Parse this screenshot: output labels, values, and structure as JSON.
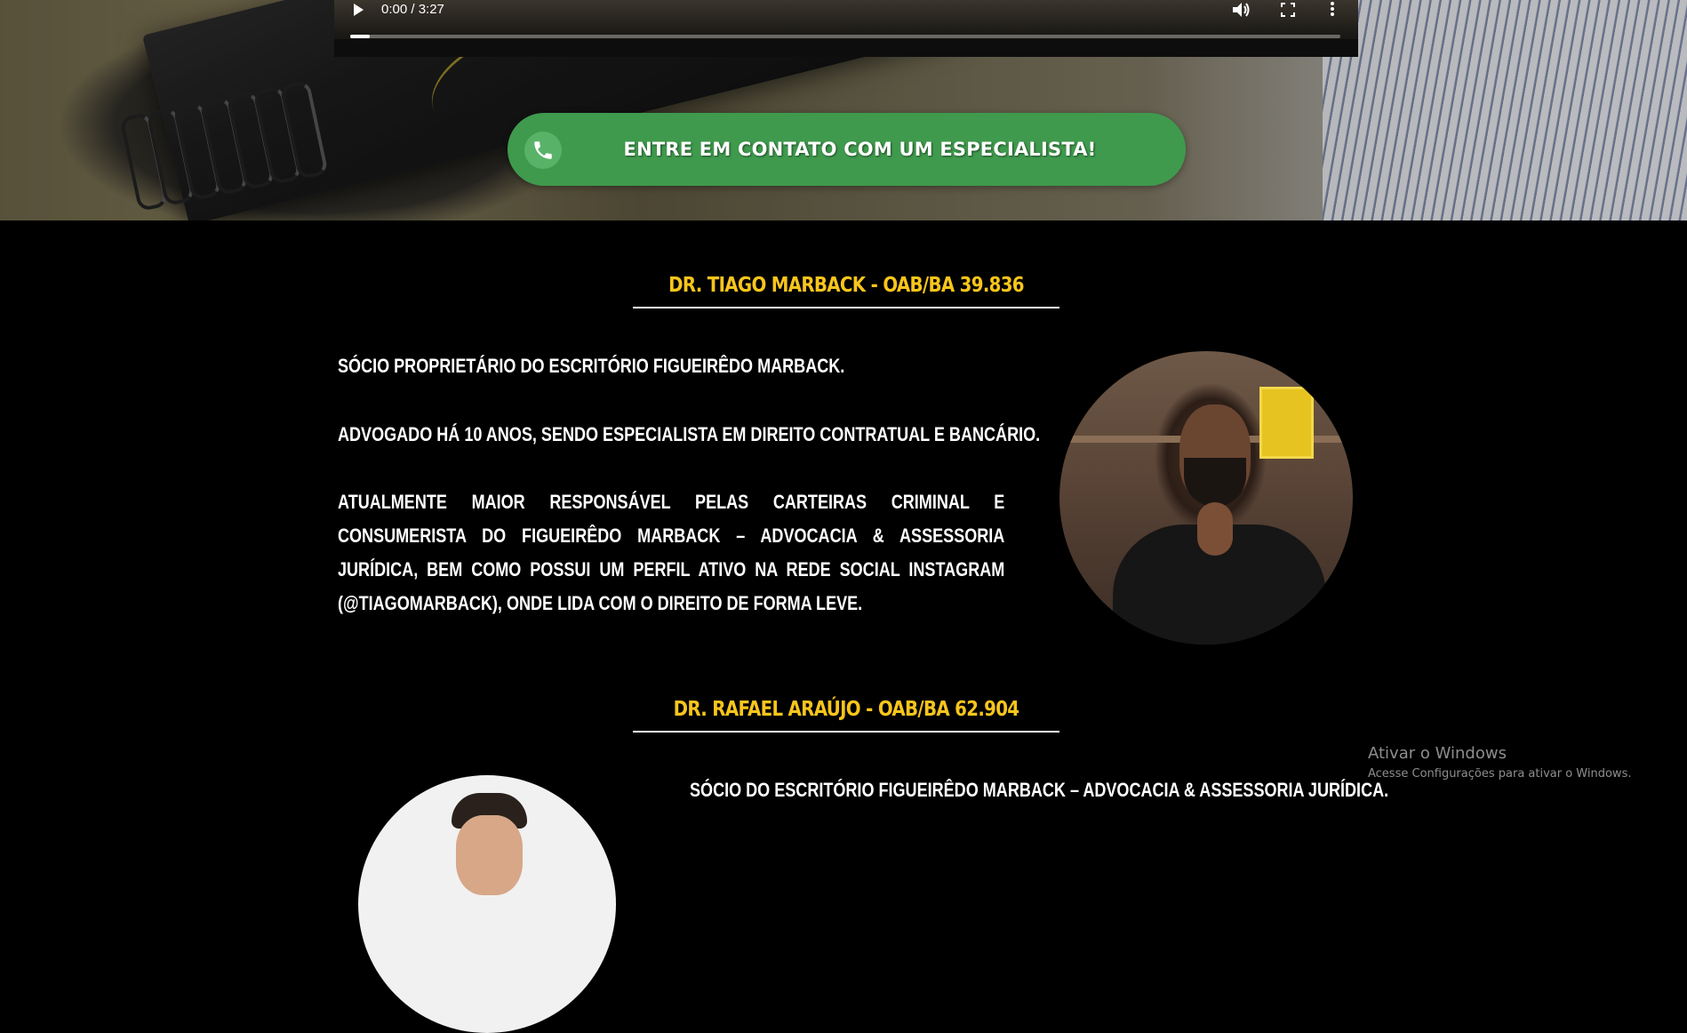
{
  "video": {
    "time": "0:00 / 3:27",
    "progress": 0.02,
    "icons": [
      "play-icon",
      "volume-icon",
      "fullscreen-icon",
      "more-options-icon"
    ]
  },
  "cta": {
    "label": "ENTRE EM CONTATO COM UM ESPECIALISTA!",
    "icon": "phone-icon",
    "color": "#3f9a4d"
  },
  "profiles": [
    {
      "heading": "DR. TIAGO MARBACK - OAB/BA 39.836",
      "paragraphs": [
        "Sócio proprietário do escritório Figueirêdo Marback.",
        "Advogado há 10 anos, sendo especialista em Direito Contratual e Bancário.",
        "Atualmente maior responsável pelas carteiras Criminal e Consumerista do Figueirêdo Marback – Advocacia & Assessoria Jurídica, bem como possui um perfil ativo na rede social Instagram (@tiagomarback), onde lida com o direito de forma leve."
      ]
    },
    {
      "heading": "DR. RAFAEL ARAÚJO - OAB/BA 62.904",
      "paragraphs": [
        "Sócio do escritório Figueirêdo Marback – Advocacia & Assessoria Jurídica."
      ]
    }
  ],
  "watermark": {
    "title": "Ativar o Windows",
    "subtitle": "Acesse Configurações para ativar o Windows."
  },
  "colors": {
    "heading": "#f8c51c",
    "background": "#000000",
    "text": "#ffffff"
  }
}
